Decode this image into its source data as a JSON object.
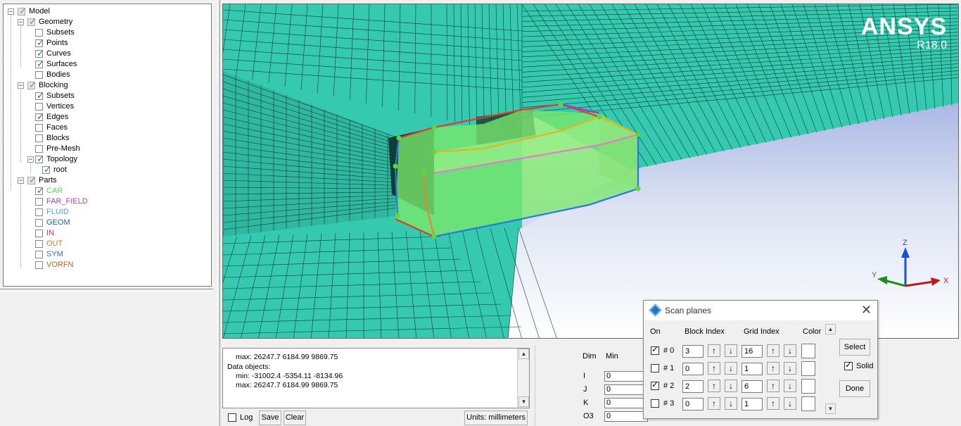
{
  "tree": {
    "items": [
      {
        "label": "Model",
        "depth": 0,
        "checked": "gray",
        "expanded": true,
        "color": "#000000"
      },
      {
        "label": "Geometry",
        "depth": 1,
        "checked": "gray",
        "expanded": true,
        "color": "#000000"
      },
      {
        "label": "Subsets",
        "depth": 2,
        "checked": "none",
        "color": "#000000"
      },
      {
        "label": "Points",
        "depth": 2,
        "checked": "on",
        "color": "#000000"
      },
      {
        "label": "Curves",
        "depth": 2,
        "checked": "on",
        "color": "#000000"
      },
      {
        "label": "Surfaces",
        "depth": 2,
        "checked": "on",
        "color": "#000000"
      },
      {
        "label": "Bodies",
        "depth": 2,
        "checked": "none",
        "color": "#000000"
      },
      {
        "label": "Blocking",
        "depth": 1,
        "checked": "gray",
        "expanded": true,
        "color": "#000000"
      },
      {
        "label": "Subsets",
        "depth": 2,
        "checked": "on",
        "color": "#000000"
      },
      {
        "label": "Vertices",
        "depth": 2,
        "checked": "none",
        "color": "#000000"
      },
      {
        "label": "Edges",
        "depth": 2,
        "checked": "on",
        "color": "#000000"
      },
      {
        "label": "Faces",
        "depth": 2,
        "checked": "none",
        "color": "#000000"
      },
      {
        "label": "Blocks",
        "depth": 2,
        "checked": "none",
        "color": "#000000"
      },
      {
        "label": "Pre-Mesh",
        "depth": 2,
        "checked": "none",
        "color": "#000000"
      },
      {
        "label": "Topology",
        "depth": 2,
        "checked": "on",
        "expanded": true,
        "color": "#000000"
      },
      {
        "label": "root",
        "depth": 3,
        "checked": "on",
        "color": "#000000"
      },
      {
        "label": "Parts",
        "depth": 1,
        "checked": "gray",
        "expanded": true,
        "color": "#000000"
      },
      {
        "label": "CAR",
        "depth": 2,
        "checked": "on",
        "color": "#5cd65c"
      },
      {
        "label": "FAR_FIELD",
        "depth": 2,
        "checked": "none",
        "color": "#b040b0"
      },
      {
        "label": "FLUID",
        "depth": 2,
        "checked": "none",
        "color": "#40b0d0"
      },
      {
        "label": "GEOM",
        "depth": 2,
        "checked": "none",
        "color": "#2060b0"
      },
      {
        "label": "IN",
        "depth": 2,
        "checked": "none",
        "color": "#c03070"
      },
      {
        "label": "OUT",
        "depth": 2,
        "checked": "none",
        "color": "#d08020"
      },
      {
        "label": "SYM",
        "depth": 2,
        "checked": "none",
        "color": "#3070c0"
      },
      {
        "label": "VORFN",
        "depth": 2,
        "checked": "none",
        "color": "#c06020"
      }
    ]
  },
  "viewport": {
    "brand": "ANSYS",
    "version": "R18.0",
    "axes": {
      "x": "X",
      "y": "Y",
      "z": "Z"
    },
    "mesh_color": "#35c9b0",
    "block_color": "#7be86a"
  },
  "messages": {
    "lines": [
      "max: 26247.7 6184.99 9869.75",
      "Data objects:",
      "min: -31002.4 -5354.11 -8134.96",
      "max: 26247.7 6184.99 9869.75"
    ],
    "log_label": "Log",
    "save_label": "Save",
    "clear_label": "Clear",
    "units_label": "Units: millimeters"
  },
  "dims": {
    "header_dim": "Dim",
    "header_min": "Min",
    "rows": [
      {
        "label": "I",
        "value": "0"
      },
      {
        "label": "J",
        "value": "0"
      },
      {
        "label": "K",
        "value": "0"
      },
      {
        "label": "O3",
        "value": "0"
      }
    ]
  },
  "scan_planes": {
    "title": "Scan planes",
    "header_on": "On",
    "header_block": "Block Index",
    "header_grid": "Grid Index",
    "header_color": "Color",
    "rows": [
      {
        "name": "# 0",
        "on": true,
        "block": "3",
        "grid": "16"
      },
      {
        "name": "# 1",
        "on": false,
        "block": "0",
        "grid": "1"
      },
      {
        "name": "# 2",
        "on": true,
        "block": "2",
        "grid": "6"
      },
      {
        "name": "# 3",
        "on": false,
        "block": "0",
        "grid": "1"
      }
    ],
    "select_label": "Select",
    "solid_label": "Solid",
    "solid_checked": true,
    "done_label": "Done"
  }
}
